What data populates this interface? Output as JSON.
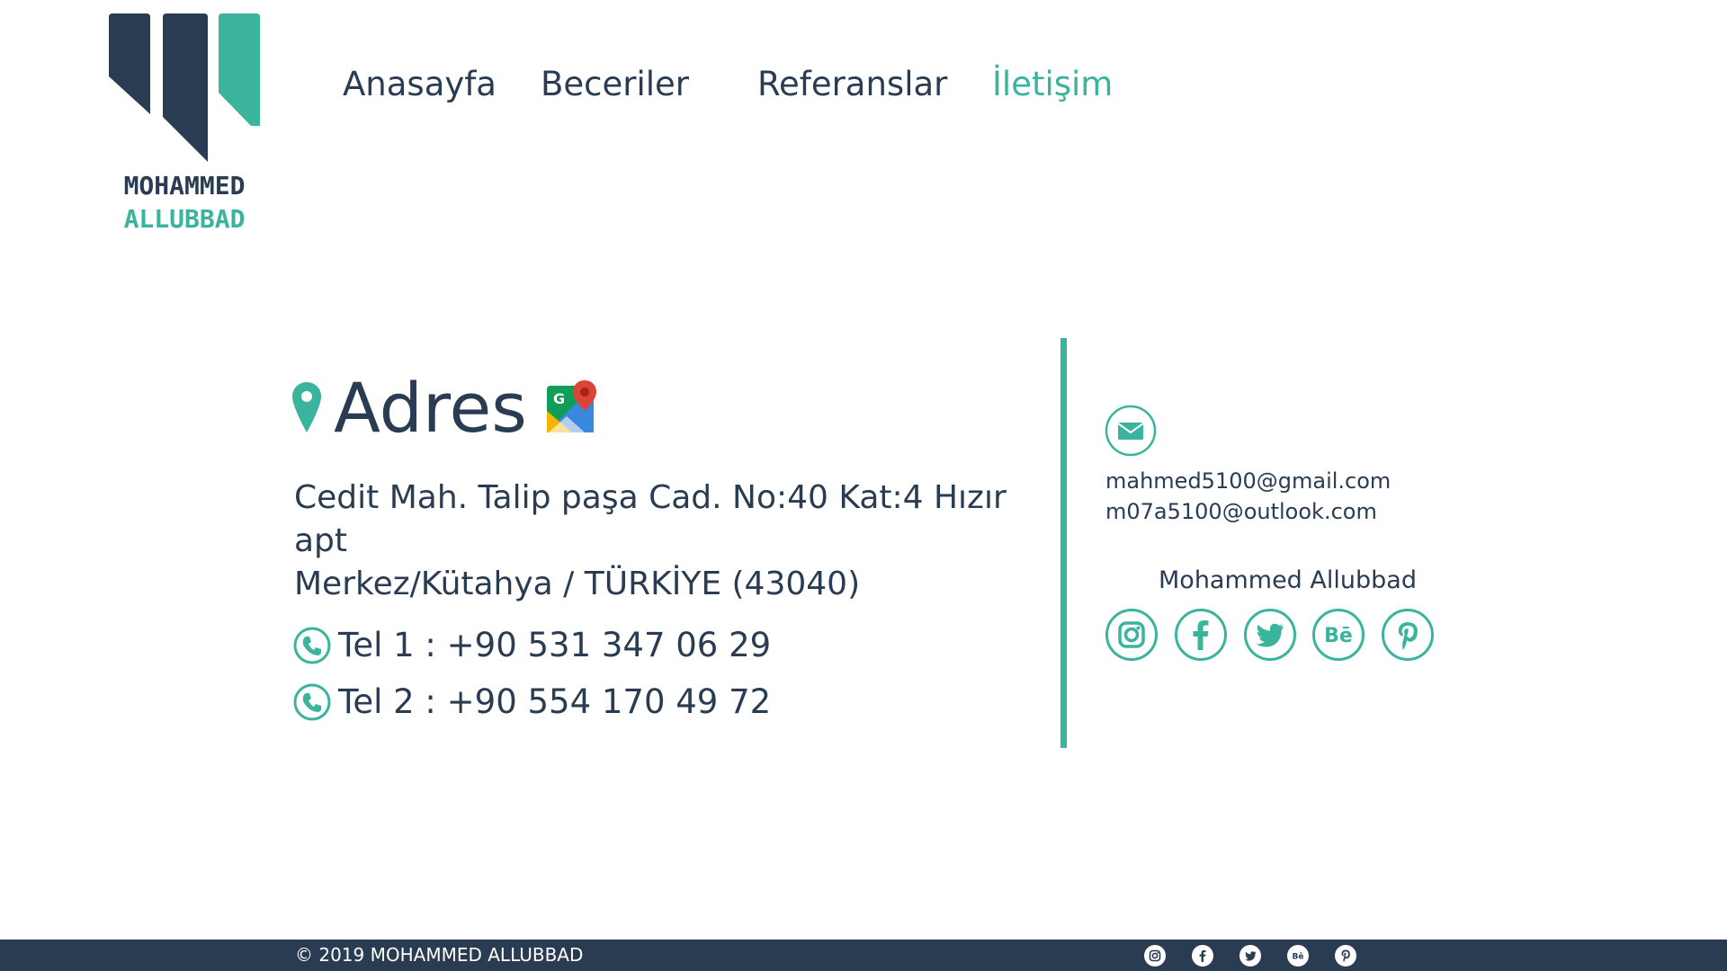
{
  "brand": {
    "line1": "MOHAMMED",
    "line2": "ALLUBBAD",
    "color_dark": "#2a3c52",
    "color_accent": "#3ab49c"
  },
  "nav": {
    "items": [
      {
        "label": "Anasayfa",
        "active": false
      },
      {
        "label": "Beceriler",
        "active": false
      },
      {
        "label": "Referanslar",
        "active": false
      },
      {
        "label": "İletişim",
        "active": true
      }
    ]
  },
  "address": {
    "title": "Adres",
    "icon": "map-pin-icon",
    "maps_icon": "google-maps-icon",
    "line1": "Cedit Mah. Talip paşa Cad. No:40 Kat:4 Hızır apt",
    "line2": "Merkez/Kütahya / TÜRKİYE (43040)"
  },
  "phones": [
    {
      "label": "Tel 1 : +90 531 347 06 29",
      "icon": "phone-icon"
    },
    {
      "label": "Tel 2 : +90 554 170 49 72",
      "icon": "phone-icon"
    }
  ],
  "contact": {
    "mail_icon": "envelope-icon",
    "emails": [
      "mahmed5100@gmail.com",
      "m07a5100@outlook.com"
    ],
    "social_name": "Mohammed Allubbad",
    "social": [
      "instagram-icon",
      "facebook-icon",
      "twitter-icon",
      "behance-icon",
      "pinterest-icon"
    ]
  },
  "footer": {
    "copyright": "© 2019 MOHAMMED ALLUBBAD",
    "social": [
      "instagram-icon",
      "facebook-icon",
      "twitter-icon",
      "behance-icon",
      "pinterest-icon"
    ]
  }
}
